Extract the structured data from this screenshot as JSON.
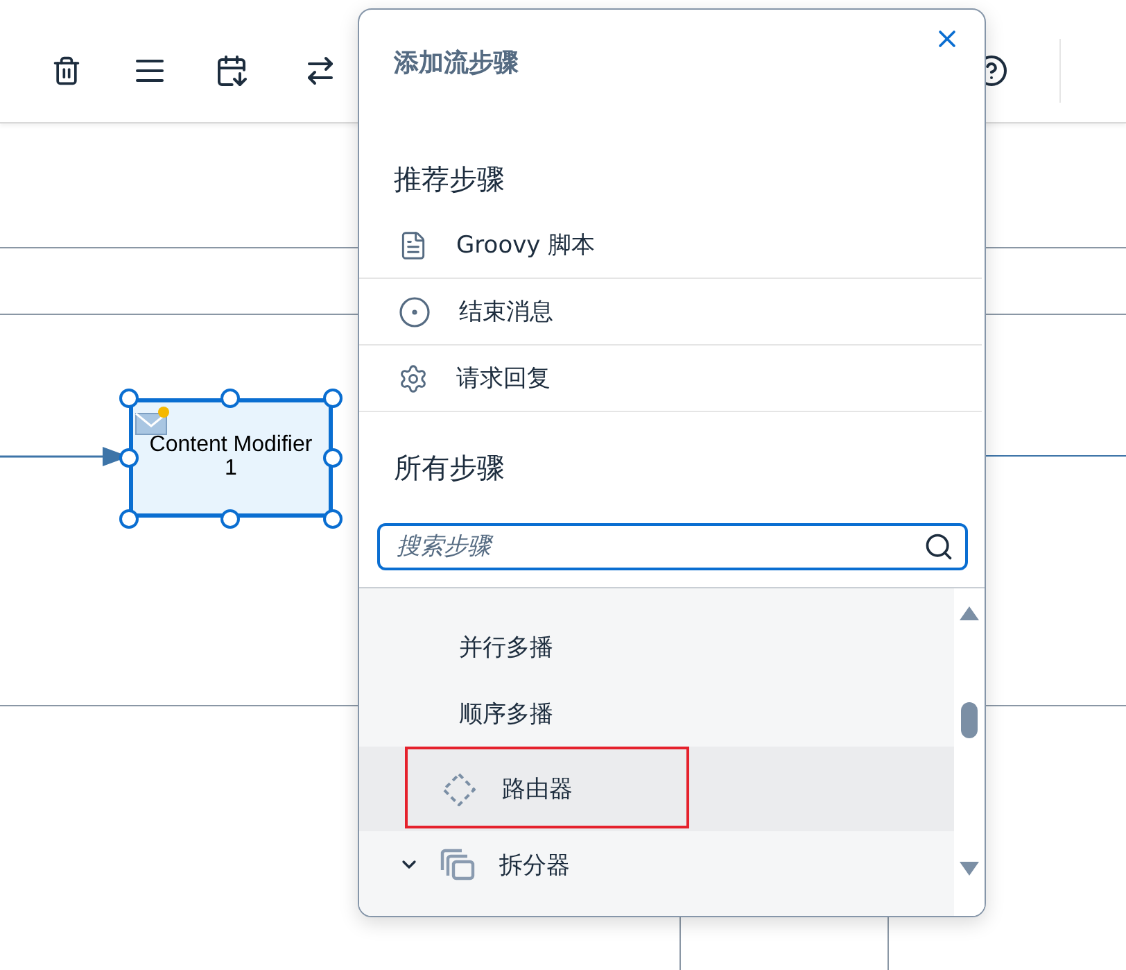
{
  "canvas": {
    "node": {
      "label": "Content Modifier",
      "index": "1",
      "selected": true
    }
  },
  "popover": {
    "title": "添加流步骤",
    "recommended": {
      "heading": "推荐步骤",
      "items": [
        {
          "label": "Groovy 脚本"
        },
        {
          "label": "结束消息"
        },
        {
          "label": "请求回复"
        }
      ]
    },
    "all": {
      "heading": "所有步骤",
      "search": {
        "placeholder": "搜索步骤"
      },
      "items": [
        {
          "kind": "plain",
          "label": "并行多播",
          "selected": false,
          "highlighted": false
        },
        {
          "kind": "plain",
          "label": "顺序多播",
          "selected": false,
          "highlighted": false
        },
        {
          "kind": "router",
          "label": "路由器",
          "selected": true,
          "highlighted": true
        },
        {
          "kind": "splitter",
          "label": "拆分器",
          "selected": false,
          "highlighted": false,
          "expanded": true
        }
      ]
    }
  }
}
